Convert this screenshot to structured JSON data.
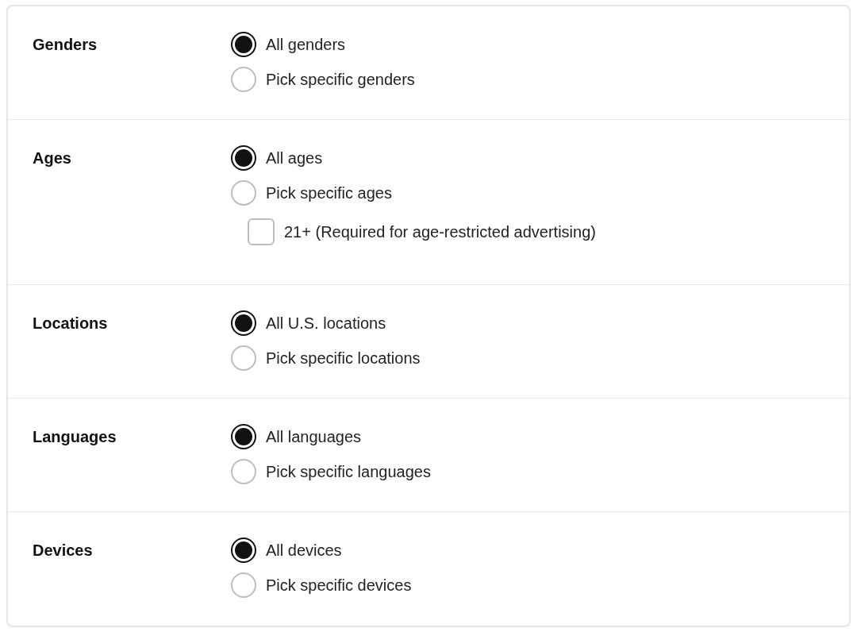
{
  "sections": [
    {
      "label": "Genders",
      "options": [
        {
          "kind": "radio",
          "label": "All genders",
          "selected": true
        },
        {
          "kind": "radio",
          "label": "Pick specific genders",
          "selected": false
        }
      ]
    },
    {
      "label": "Ages",
      "options": [
        {
          "kind": "radio",
          "label": "All ages",
          "selected": true
        },
        {
          "kind": "radio",
          "label": "Pick specific ages",
          "selected": false
        },
        {
          "kind": "checkbox",
          "label": "21+ (Required for age-restricted advertising)",
          "checked": false
        }
      ]
    },
    {
      "label": "Locations",
      "options": [
        {
          "kind": "radio",
          "label": "All U.S. locations",
          "selected": true
        },
        {
          "kind": "radio",
          "label": "Pick specific locations",
          "selected": false
        }
      ]
    },
    {
      "label": "Languages",
      "options": [
        {
          "kind": "radio",
          "label": "All languages",
          "selected": true
        },
        {
          "kind": "radio",
          "label": "Pick specific languages",
          "selected": false
        }
      ]
    },
    {
      "label": "Devices",
      "options": [
        {
          "kind": "radio",
          "label": "All devices",
          "selected": true
        },
        {
          "kind": "radio",
          "label": "Pick specific devices",
          "selected": false
        }
      ]
    }
  ]
}
